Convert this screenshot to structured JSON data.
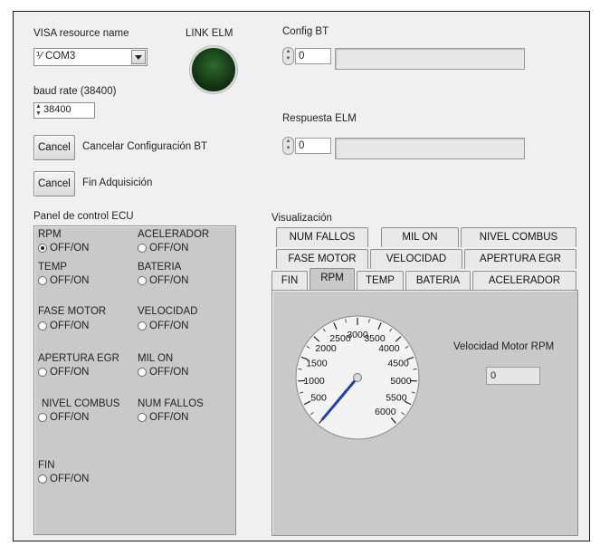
{
  "visa": {
    "label": "VISA resource name",
    "value": "COM3",
    "prefix_glyph": "⅟",
    "dropdown_icon": "chevron-down-icon"
  },
  "link_elm": {
    "label": "LINK ELM",
    "led_color": "#1f4d1f"
  },
  "baud": {
    "label": "baud rate (38400)",
    "value": "38400"
  },
  "config_bt": {
    "label": "Config BT",
    "value": "0"
  },
  "respuesta_elm": {
    "label": "Respuesta ELM",
    "value": "0"
  },
  "buttons": [
    {
      "label": "Cancel",
      "caption": "Cancelar Configuración BT"
    },
    {
      "label": "Cancel",
      "caption": "Fin Adquisición"
    }
  ],
  "control_panel": {
    "title": "Panel de control ECU",
    "radios": [
      {
        "name": "RPM",
        "option": "OFF/ON",
        "selected": true
      },
      {
        "name": "ACELERADOR",
        "option": "OFF/ON",
        "selected": false
      },
      {
        "name": "TEMP",
        "option": "OFF/ON",
        "selected": false
      },
      {
        "name": "BATERIA",
        "option": "OFF/ON",
        "selected": false
      },
      {
        "name": "FASE MOTOR",
        "option": "OFF/ON",
        "selected": false
      },
      {
        "name": "VELOCIDAD",
        "option": "OFF/ON",
        "selected": false
      },
      {
        "name": "APERTURA EGR",
        "option": "OFF/ON",
        "selected": false
      },
      {
        "name": "MIL ON",
        "option": "OFF/ON",
        "selected": false
      },
      {
        "name": "NIVEL COMBUS",
        "option": "OFF/ON",
        "selected": false
      },
      {
        "name": "NUM FALLOS",
        "option": "OFF/ON",
        "selected": false
      },
      {
        "name": "FIN",
        "option": "OFF/ON",
        "selected": false
      }
    ]
  },
  "visualizacion": {
    "title": "Visualización",
    "tab_rows": [
      [
        "NUM FALLOS",
        "MIL ON",
        "NIVEL COMBUS"
      ],
      [
        "FASE MOTOR",
        "VELOCIDAD",
        "APERTURA EGR"
      ],
      [
        "FIN",
        "RPM",
        "TEMP",
        "BATERIA",
        "ACELERADOR"
      ]
    ],
    "active_tab": "RPM",
    "gauge": {
      "min": 0,
      "max": 6000,
      "tick_labels": [
        "500",
        "1000",
        "1500",
        "2000",
        "2500",
        "3000",
        "3500",
        "4000",
        "4500",
        "5000",
        "5500",
        "6000"
      ],
      "needle_value": 0,
      "needle_color": "#1f3fae"
    },
    "speed_label": "Velocidad Motor RPM",
    "speed_value": "0"
  }
}
